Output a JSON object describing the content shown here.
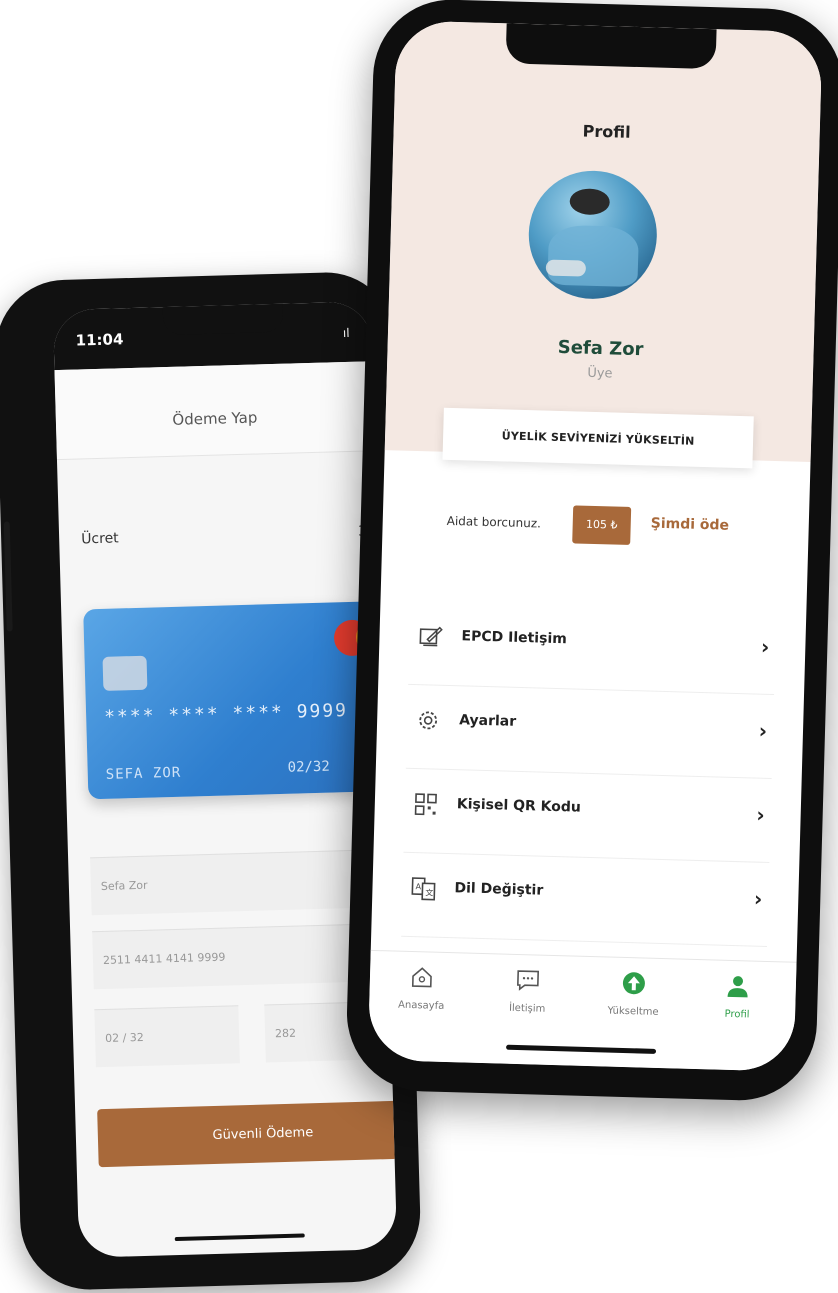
{
  "payment_screen": {
    "status_time": "11:04",
    "status_signal": "ıl",
    "title": "Ödeme Yap",
    "fee_label": "Ücret",
    "fee_value_partial": "3",
    "card": {
      "number": "**** **** **** 9999",
      "holder": "SEFA ZOR",
      "expiry": "02/32",
      "brand": "master"
    },
    "fields": {
      "name": "Sefa Zor",
      "card_number": "2511 4411 4141 9999",
      "expiry": "02 / 32",
      "cvv": "282"
    },
    "pay_button": "Güvenli Ödeme"
  },
  "profile_screen": {
    "title": "Profil",
    "user_name": "Sefa Zor",
    "user_role": "Üye",
    "upgrade_button": "ÜYELİK SEVİYENİZİ YÜKSELTİN",
    "dues_label": "Aidat borcunuz.",
    "dues_amount": "105 ₺",
    "pay_now": "Şimdi öde",
    "menu": [
      {
        "label": "EPCD Iletişim",
        "icon": "edit-icon"
      },
      {
        "label": "Ayarlar",
        "icon": "gear-icon"
      },
      {
        "label": "Kişisel QR Kodu",
        "icon": "qr-code-icon"
      },
      {
        "label": "Dil Değiştir",
        "icon": "language-icon"
      }
    ],
    "tabs": [
      {
        "label": "Anasayfa",
        "icon": "home-icon"
      },
      {
        "label": "İletişim",
        "icon": "chat-icon"
      },
      {
        "label": "Yükseltme",
        "icon": "upgrade-icon"
      },
      {
        "label": "Profil",
        "icon": "user-icon"
      }
    ]
  },
  "colors": {
    "accent_brown": "#a8693a",
    "profile_bg": "#f4e8e2",
    "active_green": "#2e9e49",
    "name_green": "#1f4c3a"
  }
}
